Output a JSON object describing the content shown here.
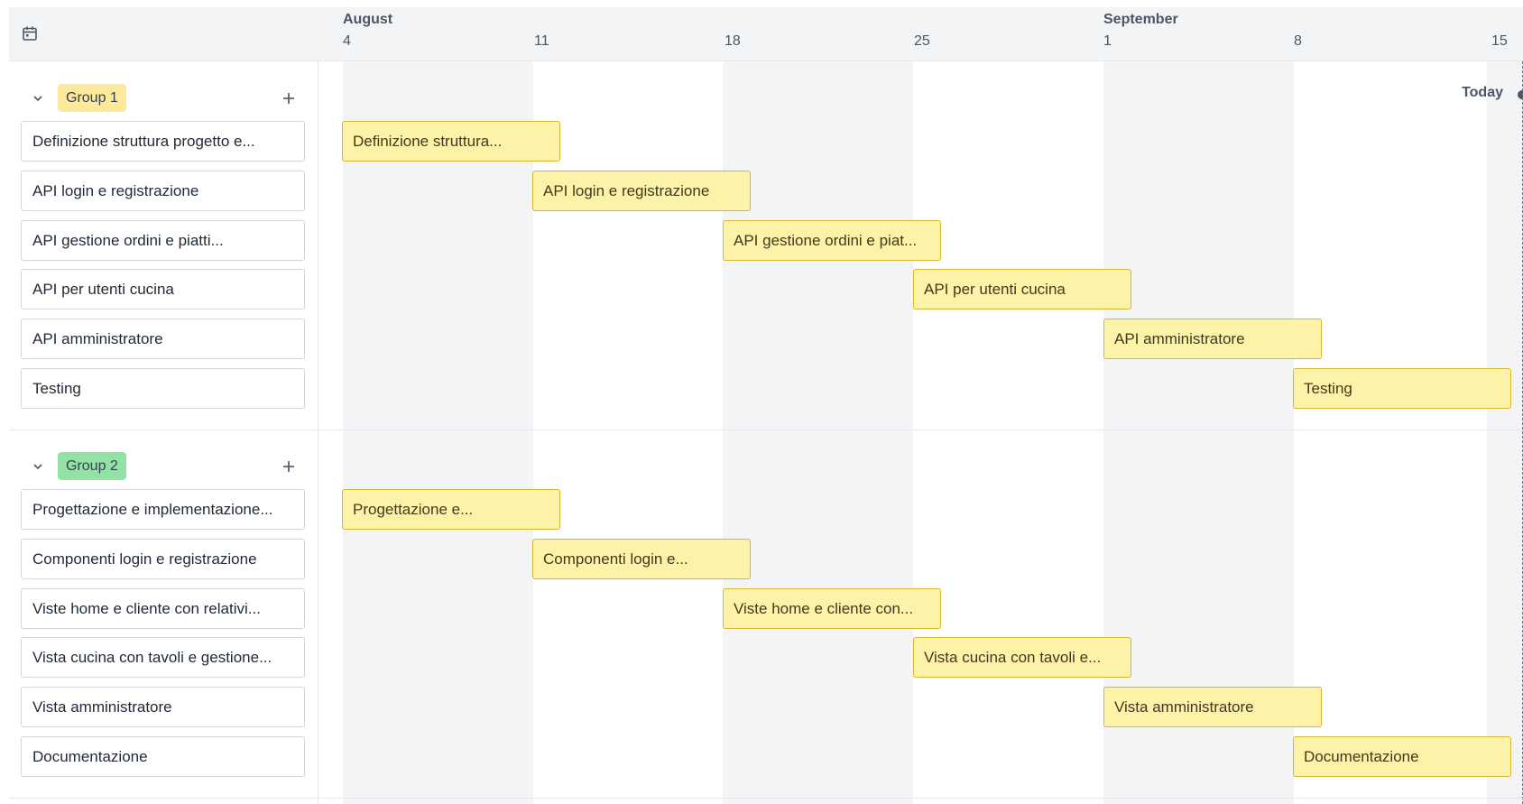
{
  "timeline": {
    "months": [
      {
        "label": "August"
      },
      {
        "label": "September"
      }
    ],
    "weeks": [
      "4",
      "11",
      "18",
      "25",
      "1",
      "8",
      "15"
    ],
    "today_label": "Today"
  },
  "groups": [
    {
      "label": "Group 1",
      "color": "#fde99a",
      "tasks": [
        {
          "name": "Definizione struttura progetto e...",
          "bar_label": "Definizione struttura..."
        },
        {
          "name": "API login e registrazione",
          "bar_label": "API login e registrazione"
        },
        {
          "name": "API gestione ordini e piatti...",
          "bar_label": "API gestione ordini e piat..."
        },
        {
          "name": "API per utenti cucina",
          "bar_label": "API per utenti cucina"
        },
        {
          "name": "API amministratore",
          "bar_label": "API amministratore"
        },
        {
          "name": "Testing",
          "bar_label": "Testing"
        }
      ]
    },
    {
      "label": "Group 2",
      "color": "#93e2a5",
      "tasks": [
        {
          "name": "Progettazione e implementazione...",
          "bar_label": "Progettazione e..."
        },
        {
          "name": "Componenti login e registrazione",
          "bar_label": "Componenti login e..."
        },
        {
          "name": "Viste home e cliente con relativi...",
          "bar_label": "Viste home e cliente con..."
        },
        {
          "name": "Vista cucina con tavoli e gestione...",
          "bar_label": "Vista cucina con tavoli e..."
        },
        {
          "name": "Vista amministratore",
          "bar_label": "Vista amministratore"
        },
        {
          "name": "Documentazione",
          "bar_label": "Documentazione"
        }
      ]
    }
  ],
  "icons": {
    "calendar": "calendar-icon",
    "collapse": "chevron-down-icon",
    "add": "plus-icon"
  },
  "colors": {
    "bar_fill": "#fdf3a8",
    "bar_border": "#d9b62d",
    "weekend_band": "#f3f4f6"
  }
}
